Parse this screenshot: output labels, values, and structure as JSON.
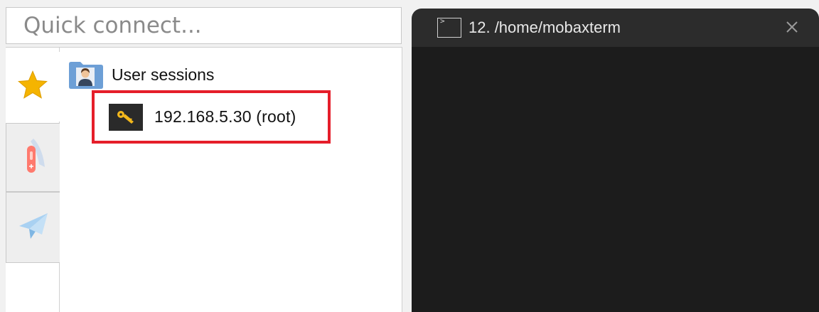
{
  "quick_connect": {
    "placeholder": "Quick connect..."
  },
  "sidebar": {
    "tabs": [
      {
        "name": "sessions",
        "icon": "star-icon",
        "color": "#f5b400"
      },
      {
        "name": "tools",
        "icon": "knife-icon",
        "color": "#ff7a6e"
      },
      {
        "name": "send",
        "icon": "paper-plane-icon",
        "color": "#8cc0ea"
      }
    ]
  },
  "session_tree": {
    "folder_label": "User sessions",
    "folder_icon": "user-folder-icon",
    "sessions": [
      {
        "label": "192.168.5.30 (root)",
        "icon": "key-icon",
        "highlighted": true,
        "highlight_color": "#e51e2a"
      }
    ]
  },
  "terminal": {
    "tab_title": "12. /home/mobaxterm",
    "tab_icon": "terminal-icon",
    "close_icon": "close-icon",
    "background": "#1c1c1c"
  }
}
